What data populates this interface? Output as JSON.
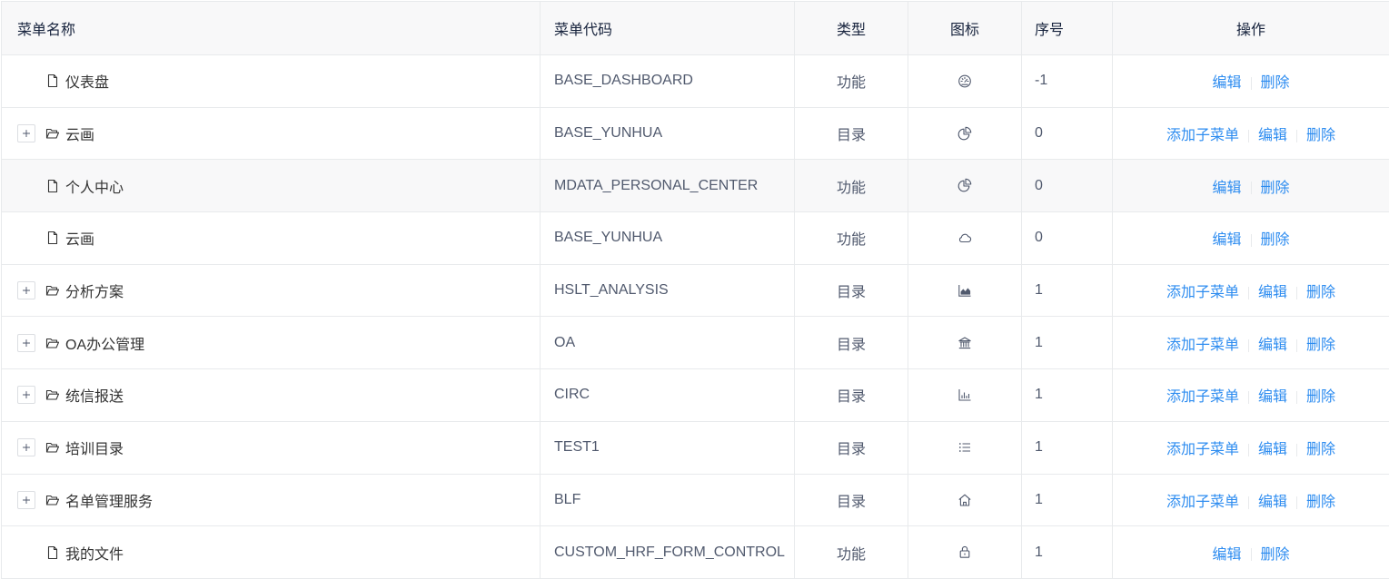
{
  "table": {
    "headers": {
      "name": "菜单名称",
      "code": "菜单代码",
      "type": "类型",
      "icon": "图标",
      "order": "序号",
      "actions": "操作"
    },
    "rows": [
      {
        "name": "仪表盘",
        "node_icon": "file-icon",
        "expandable": false,
        "code": "BASE_DASHBOARD",
        "type": "功能",
        "icon": "dashboard-icon",
        "order": -1,
        "actions": {
          "edit": "编辑",
          "delete": "删除"
        }
      },
      {
        "name": "云画",
        "node_icon": "folder-open-icon",
        "expandable": true,
        "code": "BASE_YUNHUA",
        "type": "目录",
        "icon": "pie-chart-icon",
        "order": 0,
        "actions": {
          "add_child": "添加子菜单",
          "edit": "编辑",
          "delete": "删除"
        }
      },
      {
        "name": "个人中心",
        "node_icon": "file-icon",
        "expandable": false,
        "code": "MDATA_PERSONAL_CENTER",
        "type": "功能",
        "icon": "pie-chart-icon",
        "order": 0,
        "actions": {
          "edit": "编辑",
          "delete": "删除"
        }
      },
      {
        "name": "云画",
        "node_icon": "file-icon",
        "expandable": false,
        "code": "BASE_YUNHUA",
        "type": "功能",
        "icon": "cloud-icon",
        "order": 0,
        "actions": {
          "edit": "编辑",
          "delete": "删除"
        }
      },
      {
        "name": "分析方案",
        "node_icon": "folder-open-icon",
        "expandable": true,
        "code": "HSLT_ANALYSIS",
        "type": "目录",
        "icon": "area-chart-icon",
        "order": 1,
        "actions": {
          "add_child": "添加子菜单",
          "edit": "编辑",
          "delete": "删除"
        }
      },
      {
        "name": "OA办公管理",
        "node_icon": "folder-open-icon",
        "expandable": true,
        "code": "OA",
        "type": "目录",
        "icon": "bank-icon",
        "order": 1,
        "actions": {
          "add_child": "添加子菜单",
          "edit": "编辑",
          "delete": "删除"
        }
      },
      {
        "name": "统信报送",
        "node_icon": "folder-open-icon",
        "expandable": true,
        "code": "CIRC",
        "type": "目录",
        "icon": "bar-chart-icon",
        "order": 1,
        "actions": {
          "add_child": "添加子菜单",
          "edit": "编辑",
          "delete": "删除"
        }
      },
      {
        "name": "培训目录",
        "node_icon": "folder-open-icon",
        "expandable": true,
        "code": "TEST1",
        "type": "目录",
        "icon": "list-icon",
        "order": 1,
        "actions": {
          "add_child": "添加子菜单",
          "edit": "编辑",
          "delete": "删除"
        }
      },
      {
        "name": "名单管理服务",
        "node_icon": "folder-open-icon",
        "expandable": true,
        "code": "BLF",
        "type": "目录",
        "icon": "home-icon",
        "order": 1,
        "actions": {
          "add_child": "添加子菜单",
          "edit": "编辑",
          "delete": "删除"
        }
      },
      {
        "name": "我的文件",
        "node_icon": "file-icon",
        "expandable": false,
        "code": "CUSTOM_HRF_FORM_CONTROL",
        "type": "功能",
        "icon": "lock-icon",
        "order": 1,
        "actions": {
          "edit": "编辑",
          "delete": "删除"
        }
      }
    ]
  },
  "colors": {
    "link": "#2d8cf0",
    "text": "#515a6e",
    "header_background": "#f8f8f9",
    "border": "#e8eaec"
  }
}
